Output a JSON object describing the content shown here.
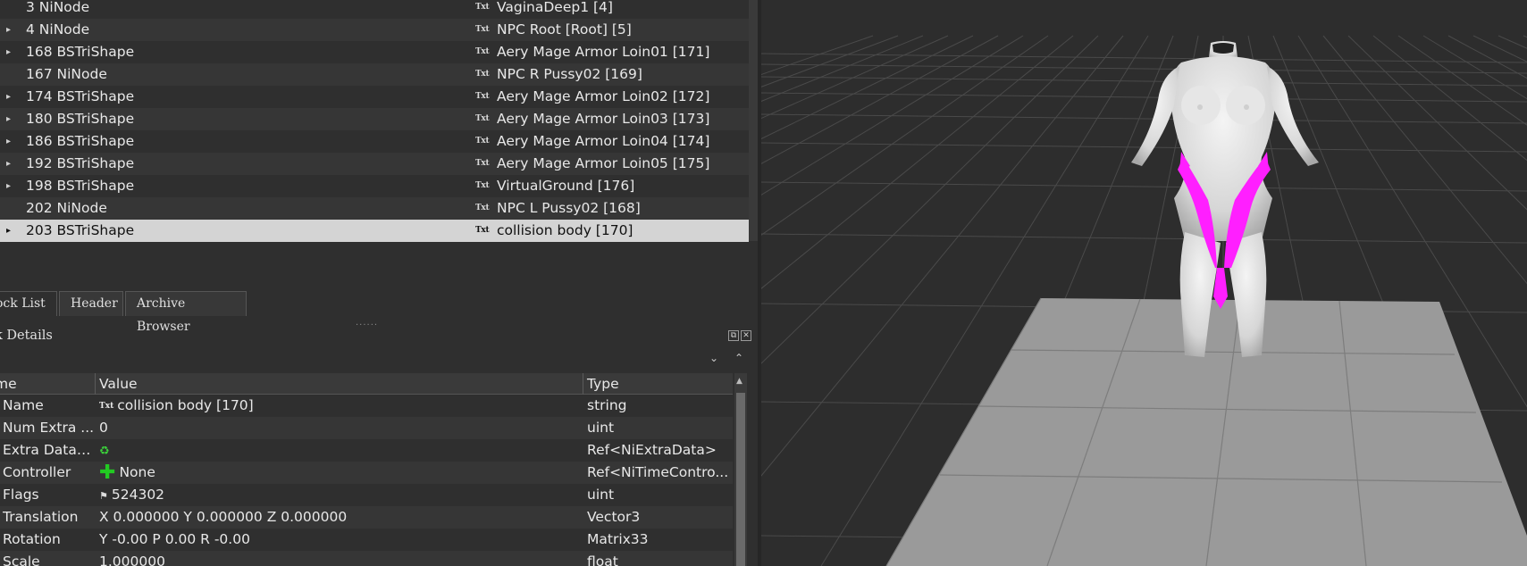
{
  "tree": {
    "rows": [
      {
        "expand": "",
        "block": "3 NiNode",
        "txt": "Txt",
        "value": "VaginaDeep1 [4]"
      },
      {
        "expand": "▸",
        "block": "4 NiNode",
        "txt": "Txt",
        "value": "NPC Root [Root] [5]"
      },
      {
        "expand": "▸",
        "block": "168 BSTriShape",
        "txt": "Txt",
        "value": "Aery Mage Armor Loin01 [171]"
      },
      {
        "expand": "",
        "block": "167 NiNode",
        "txt": "Txt",
        "value": "NPC R Pussy02 [169]"
      },
      {
        "expand": "▸",
        "block": "174 BSTriShape",
        "txt": "Txt",
        "value": "Aery Mage Armor Loin02 [172]"
      },
      {
        "expand": "▸",
        "block": "180 BSTriShape",
        "txt": "Txt",
        "value": "Aery Mage Armor Loin03 [173]"
      },
      {
        "expand": "▸",
        "block": "186 BSTriShape",
        "txt": "Txt",
        "value": "Aery Mage Armor Loin04 [174]"
      },
      {
        "expand": "▸",
        "block": "192 BSTriShape",
        "txt": "Txt",
        "value": "Aery Mage Armor Loin05 [175]"
      },
      {
        "expand": "▸",
        "block": "198 BSTriShape",
        "txt": "Txt",
        "value": "VirtualGround [176]"
      },
      {
        "expand": "",
        "block": "202 NiNode",
        "txt": "Txt",
        "value": "NPC L Pussy02 [168]"
      },
      {
        "expand": "▸",
        "block": "203 BSTriShape",
        "txt": "Txt",
        "value": "collision body [170]"
      }
    ]
  },
  "tabs": {
    "block_list": "ock List",
    "header": "Header",
    "archive_browser": "Archive Browser"
  },
  "splitter_dots": "......",
  "details": {
    "title": "k Details",
    "float_glyph": "⧉",
    "close_glyph": "✕",
    "collapse_down": "⌄",
    "collapse_up": "⌃"
  },
  "grid": {
    "headers": {
      "name": "me",
      "value": "Value",
      "type": "Type"
    },
    "rows": [
      {
        "name": "Name",
        "icon": "txt-icon",
        "icon_glyph": "Txt",
        "value": "collision body [170]",
        "type": "string"
      },
      {
        "name": "Num Extra ...",
        "icon": "",
        "icon_glyph": "",
        "value": "0",
        "type": "uint"
      },
      {
        "name": "Extra Data L...",
        "icon": "link-icon",
        "icon_glyph": "♻",
        "value": "",
        "type": "Ref<NiExtraData>"
      },
      {
        "name": "Controller",
        "icon": "plus-icon",
        "icon_glyph": "✚",
        "value": "None",
        "type": "Ref<NiTimeContro..."
      },
      {
        "name": "Flags",
        "icon": "flag-icon",
        "icon_glyph": "⚑",
        "value": "524302",
        "type": "uint"
      },
      {
        "name": "Translation",
        "icon": "",
        "icon_glyph": "",
        "value": "X 0.000000 Y 0.000000 Z 0.000000",
        "type": "Vector3"
      },
      {
        "name": "Rotation",
        "icon": "",
        "icon_glyph": "",
        "value": "Y -0.00 P 0.00 R -0.00",
        "type": "Matrix33"
      },
      {
        "name": "Scale",
        "icon": "",
        "icon_glyph": "",
        "value": "1.000000",
        "type": "float"
      }
    ]
  },
  "colors": {
    "selection": "#d4d4d4",
    "loincloth": "#ff1fff",
    "ground_plane": "#9a9a9a",
    "body": "#e4e4e4",
    "viewport_grid": "#4a4a4a"
  }
}
